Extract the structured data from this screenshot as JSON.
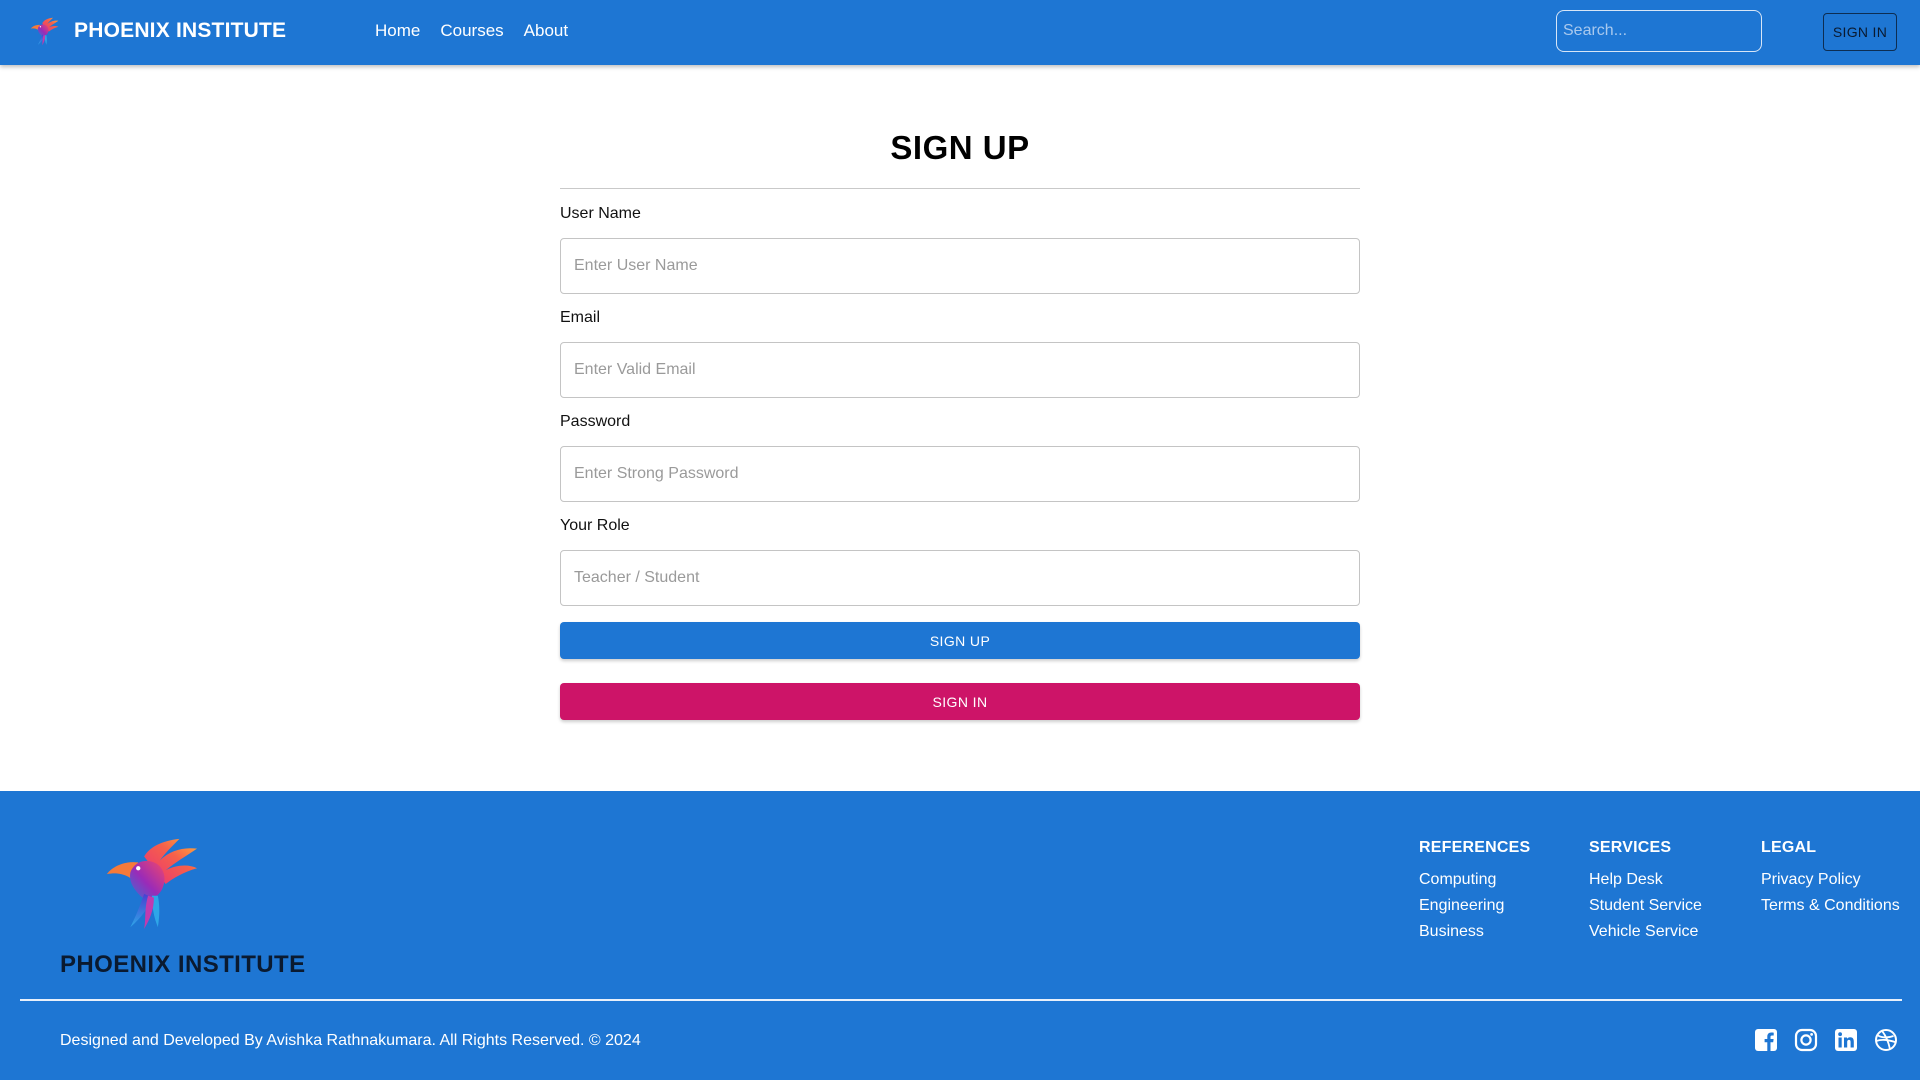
{
  "navbar": {
    "brand": "PHOENIX INSTITUTE",
    "logo_icon": "phoenix-logo-icon",
    "links": [
      "Home",
      "Courses",
      "About"
    ],
    "search_placeholder": "Search...",
    "signin_label": "SIGN IN",
    "color": "#1e76d3"
  },
  "form": {
    "title": "SIGN UP",
    "fields": [
      {
        "label": "User Name",
        "placeholder": "Enter User Name"
      },
      {
        "label": "Email",
        "placeholder": "Enter Valid Email"
      },
      {
        "label": "Password",
        "placeholder": "Enter Strong Password"
      },
      {
        "label": "Your Role",
        "placeholder": "Teacher / Student"
      }
    ],
    "signup_label": "SIGN UP",
    "signin_label": "SIGN IN",
    "signup_color": "#1e76d3",
    "signin_color": "#cd1468"
  },
  "footer": {
    "brand": "PHOENIX INSTITUTE",
    "columns": [
      {
        "title": "REFERENCES",
        "links": [
          "Computing",
          "Engineering",
          "Business"
        ]
      },
      {
        "title": "SERVICES",
        "links": [
          "Help Desk",
          "Student Service",
          "Vehicle Service"
        ]
      },
      {
        "title": "LEGAL",
        "links": [
          "Privacy Policy",
          "Terms & Conditions"
        ]
      }
    ],
    "copyright": "Designed and Developed By Avishka Rathnakumara. All Rights Reserved. © 2024",
    "socials": [
      "facebook-icon",
      "instagram-icon",
      "linkedin-icon",
      "dribbble-icon"
    ]
  }
}
